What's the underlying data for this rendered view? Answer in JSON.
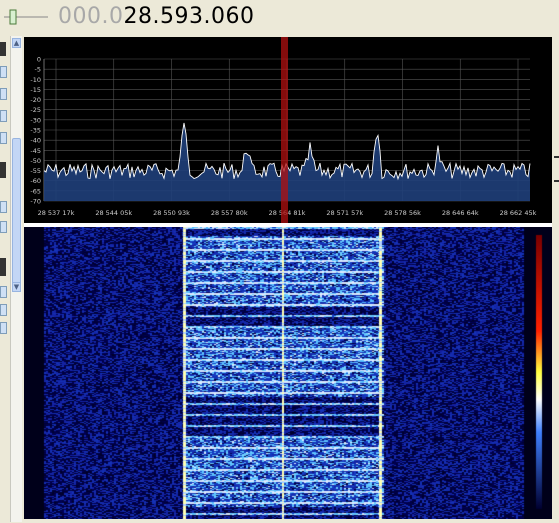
{
  "frequency": {
    "dim_part": "000.0",
    "bright_part": "28.593.060"
  },
  "spectrum": {
    "db_labels": [
      "0",
      "-5",
      "-10",
      "-15",
      "-20",
      "-25",
      "-30",
      "-35",
      "-40",
      "-45",
      "-50",
      "-55",
      "-60",
      "-65",
      "-70"
    ],
    "freq_labels": [
      "28 537 17k",
      "28 544 05k",
      "28 550 93k",
      "28 557 80k",
      "28 564 81k",
      "28 571 57k",
      "28 578 56k",
      "28 646 64k",
      "28 662 45k"
    ]
  },
  "colors": {
    "background": "#000000",
    "trace": "#ffffff",
    "fill": "#1f3f7a",
    "marker": "#b01010",
    "waterfall_bg": "#00001a"
  }
}
